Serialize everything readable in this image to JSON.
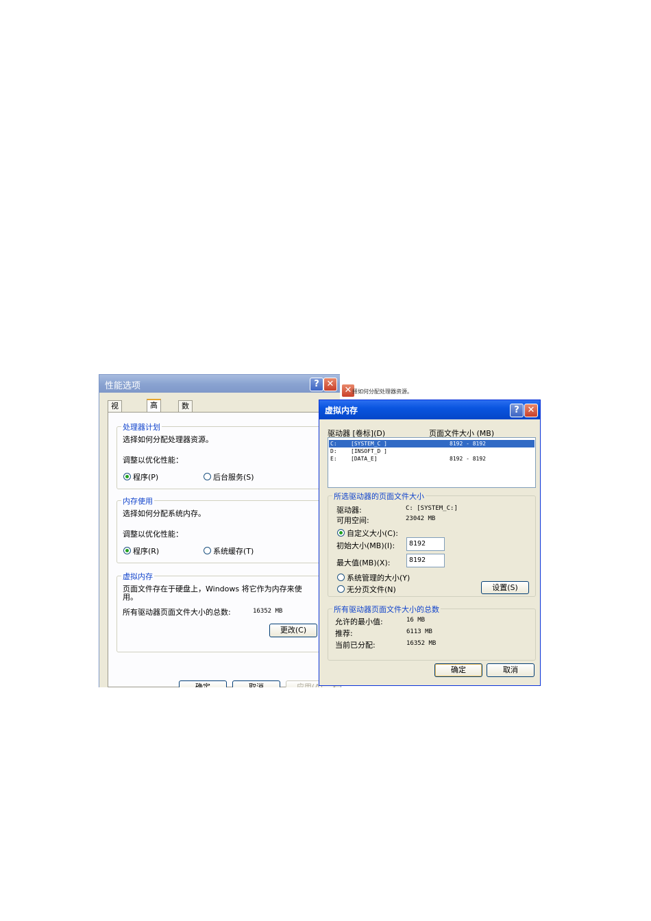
{
  "perf": {
    "title": "性能选项",
    "help": "?",
    "close": "✕",
    "tabs": [
      "视觉效果",
      "高级",
      "数据执行保护"
    ],
    "processor": {
      "title": "处理器计划",
      "desc": "选择如何分配处理器资源。",
      "adjust": "调整以优化性能：",
      "opt1": "程序(P)",
      "opt2": "后台服务(S)"
    },
    "memory": {
      "title": "内存使用",
      "desc": "选择如何分配系统内存。",
      "adjust": "调整以优化性能：",
      "opt1": "程序(R)",
      "opt2": "系统缓存(T)"
    },
    "vm": {
      "title": "虚拟内存",
      "desc1": "页面文件存在于硬盘上，Windows 将它作为内存来使",
      "desc2": "用。",
      "total_label": "所有驱动器页面文件大小的总数:",
      "total_value": "16352 MB",
      "change": "更改(C)"
    },
    "buttons": [
      "确定",
      "取消",
      "应用(A)"
    ]
  },
  "strip": {
    "text": "择如何分配处理器资源。",
    "close": "✕"
  },
  "vmem": {
    "title": "虚拟内存",
    "help": "?",
    "close": "✕",
    "col_drive": "驱动器 [卷标](D)",
    "col_size": "页面文件大小 (MB)",
    "drives": [
      {
        "letter": "C:",
        "label": "[SYSTEM_C ]",
        "size": "8192 - 8192"
      },
      {
        "letter": "D:",
        "label": "[INSOFT_D ]",
        "size": ""
      },
      {
        "letter": "E:",
        "label": "[DATA_E]",
        "size": "8192 - 8192"
      }
    ],
    "selected": {
      "title": "所选驱动器的页面文件大小",
      "drive_label": "驱动器:",
      "drive_value": "C:  [SYSTEM_C:]",
      "space_label": "可用空间:",
      "space_value": "23042 MB",
      "custom": "自定义大小(C):",
      "initial_label": "初始大小(MB)(I):",
      "initial_value": "8192",
      "max_label": "最大值(MB)(X):",
      "max_value": "8192",
      "system": "系统管理的大小(Y)",
      "none": "无分页文件(N)",
      "set": "设置(S)"
    },
    "total": {
      "title": "所有驱动器页面文件大小的总数",
      "min_label": "允许的最小值:",
      "min_value": "16 MB",
      "rec_label": "推荐:",
      "rec_value": "6113 MB",
      "cur_label": "当前已分配:",
      "cur_value": "16352 MB"
    },
    "ok": "确定",
    "cancel": "取消"
  }
}
